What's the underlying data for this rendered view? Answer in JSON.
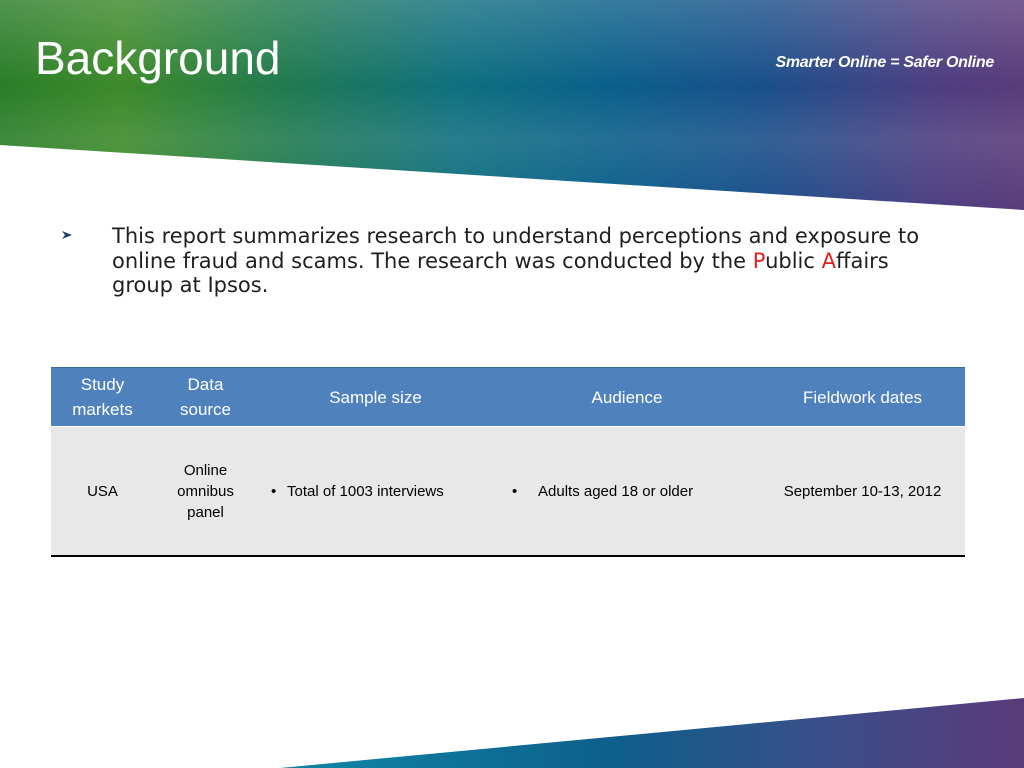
{
  "slide": {
    "title": "Background",
    "tagline": "Smarter Online = Safer Online"
  },
  "bullet": {
    "text_before_p": "This report summarizes research to understand perceptions and exposure to online fraud and scams. The research was conducted by the ",
    "red_p": "P",
    "text_after_p": "ublic ",
    "red_a": "A",
    "text_after_a": "ffairs group at Ipsos."
  },
  "table": {
    "headers": {
      "study_markets": "Study markets",
      "data_source": "Data source",
      "sample_size": "Sample size",
      "audience": "Audience",
      "fieldwork_dates": "Fieldwork dates"
    },
    "row": {
      "study_markets": "USA",
      "data_source": "Online omnibus panel",
      "sample_size": "Total of 1003  interviews",
      "audience": "Adults aged 18 or older",
      "fieldwork_dates": "September 10-13, 2012"
    },
    "bullet_glyph": "•"
  },
  "colors": {
    "header_fill": "#4f81bd",
    "row_fill": "#e8e8e8",
    "accent_red": "#e11d1d",
    "bullet_arrow": "#1f3f6a"
  },
  "icons": {
    "bullet": "chevron-right-icon"
  }
}
